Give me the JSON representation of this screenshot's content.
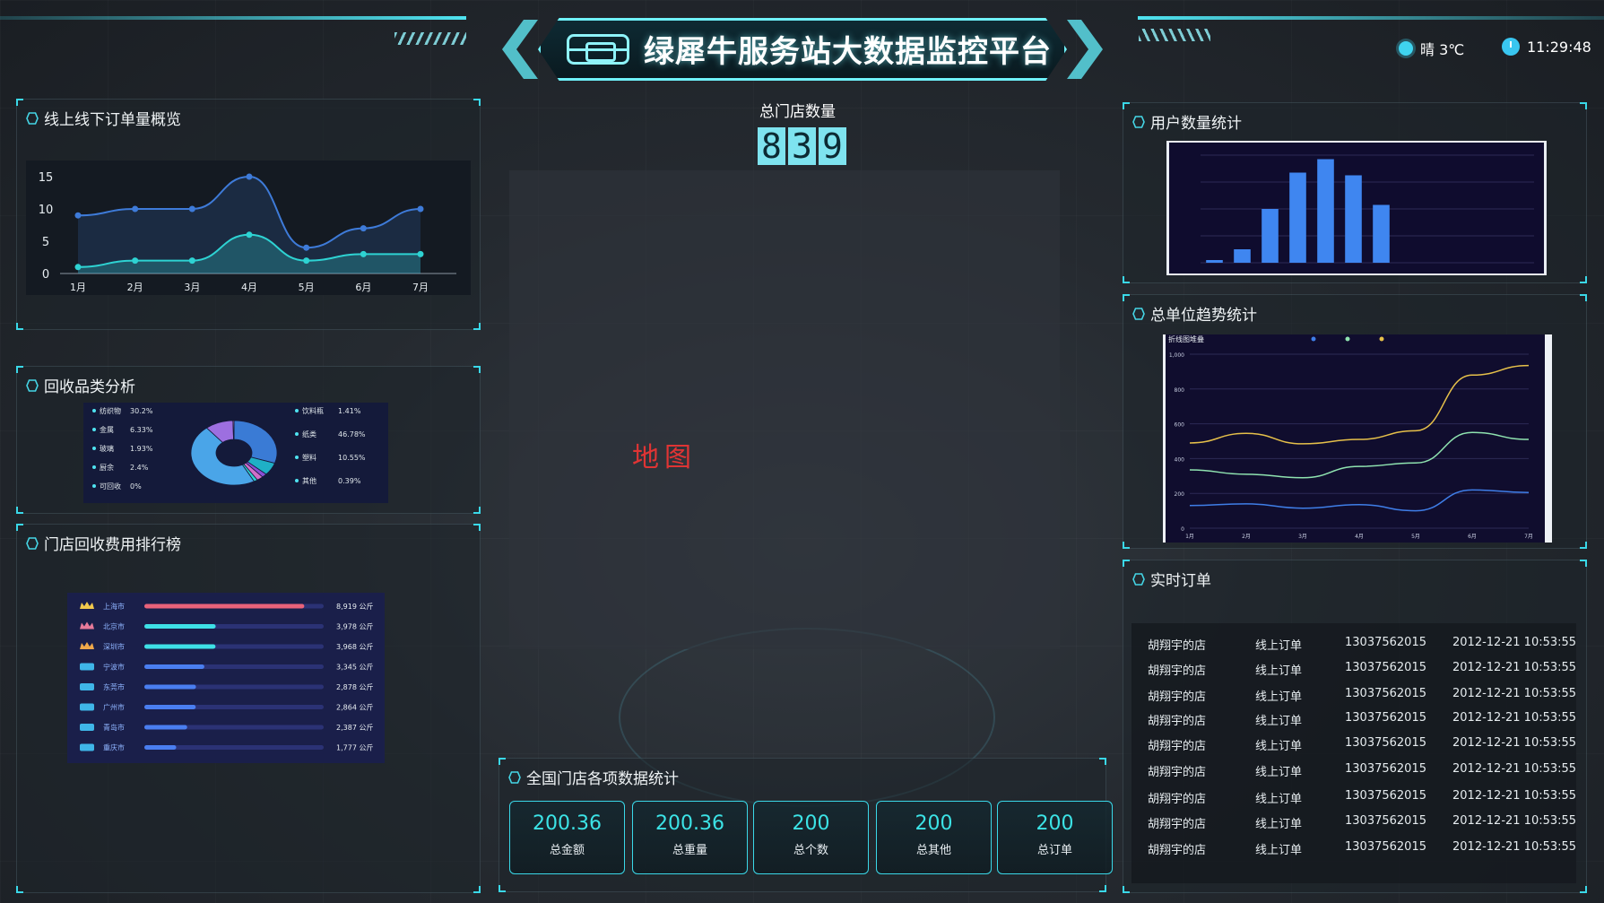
{
  "header": {
    "title": "绿犀牛服务站大数据监控平台",
    "weather": "晴 3℃",
    "time": "11:29:48",
    "icons": [
      "logo-icon",
      "sun-icon",
      "clock-icon"
    ]
  },
  "panels": {
    "online_offline": "线上线下订单量概览",
    "recycle_category": "回收品类分析",
    "store_ranking": "门店回收费用排行榜",
    "user_stats": "用户数量统计",
    "unit_trend": "总单位趋势统计",
    "realtime_orders": "实时订单",
    "national_stats": "全国门店各项数据统计"
  },
  "store_count": {
    "label": "总门店数量",
    "digits": [
      "8",
      "3",
      "9"
    ]
  },
  "map": {
    "placeholder": "地图"
  },
  "stats": [
    {
      "value": "200.36",
      "label": "总金额"
    },
    {
      "value": "200.36",
      "label": "总重量"
    },
    {
      "value": "200",
      "label": "总个数"
    },
    {
      "value": "200",
      "label": "总其他"
    },
    {
      "value": "200",
      "label": "总订单"
    }
  ],
  "chart_data": [
    {
      "type": "area",
      "categories": [
        "1月",
        "2月",
        "3月",
        "4月",
        "5月",
        "6月",
        "7月"
      ],
      "series": [
        {
          "values": [
            9,
            10,
            10,
            15,
            4,
            7,
            10
          ],
          "color": "#3e7bd9"
        },
        {
          "values": [
            1,
            2,
            2,
            6,
            2,
            3,
            3
          ],
          "color": "#2ed3d3"
        }
      ],
      "yticks": [
        "0",
        "5",
        "10",
        "15"
      ],
      "ylim": [
        0,
        15
      ]
    },
    {
      "type": "pie",
      "legend_left": [
        {
          "label": "纺织物",
          "value": "30.2%"
        },
        {
          "label": "金属",
          "value": "6.33%"
        },
        {
          "label": "玻璃",
          "value": "1.93%"
        },
        {
          "label": "厨余",
          "value": "2.4%"
        },
        {
          "label": "可回收",
          "value": "0%"
        }
      ],
      "legend_right": [
        {
          "label": "饮料瓶",
          "value": "1.41%"
        },
        {
          "label": "纸类",
          "value": "46.78%"
        },
        {
          "label": "塑料",
          "value": "10.55%"
        },
        {
          "label": "其他",
          "value": "0.39%"
        }
      ],
      "slices": [
        30.2,
        6.33,
        1.93,
        2.4,
        0,
        1.41,
        46.78,
        10.55,
        0.39
      ]
    },
    {
      "type": "bar",
      "orientation": "horizontal",
      "rows": [
        {
          "name": "上海市",
          "value": 8919,
          "label": "8,919 公斤"
        },
        {
          "name": "北京市",
          "value": 3978,
          "label": "3,978 公斤"
        },
        {
          "name": "深圳市",
          "value": 3968,
          "label": "3,968 公斤"
        },
        {
          "name": "宁波市",
          "value": 3345,
          "label": "3,345 公斤"
        },
        {
          "name": "东莞市",
          "value": 2878,
          "label": "2,878 公斤"
        },
        {
          "name": "广州市",
          "value": 2864,
          "label": "2,864 公斤"
        },
        {
          "name": "青岛市",
          "value": 2387,
          "label": "2,387 公斤"
        },
        {
          "name": "重庆市",
          "value": 1777,
          "label": "1,777 公斤"
        }
      ],
      "xlim": [
        0,
        10000
      ]
    },
    {
      "type": "bar",
      "values": [
        2,
        10,
        40,
        67,
        77,
        65,
        43,
        0,
        0,
        0,
        0,
        0
      ],
      "ylim": [
        0,
        80
      ],
      "color": "#3f86f0"
    },
    {
      "type": "line",
      "title": "折线图堆叠",
      "categories": [
        "1月",
        "2月",
        "3月",
        "4月",
        "5月",
        "6月",
        "7月"
      ],
      "series": [
        {
          "values": [
            130,
            140,
            115,
            135,
            100,
            220,
            205
          ],
          "color": "#3f7ee8"
        },
        {
          "values": [
            335,
            310,
            290,
            355,
            375,
            550,
            510
          ],
          "color": "#8fe3b0"
        },
        {
          "values": [
            490,
            545,
            485,
            510,
            560,
            880,
            935
          ],
          "color": "#e6c04a"
        }
      ],
      "yticks": [
        "0",
        "200",
        "400",
        "600",
        "800",
        "1,000"
      ],
      "ylim": [
        0,
        1000
      ]
    }
  ],
  "orders": {
    "rows": [
      {
        "store": "胡翔宇的店",
        "type": "线上订单",
        "phone": "13037562015",
        "time": "2012-12-21 10:53:55"
      },
      {
        "store": "胡翔宇的店",
        "type": "线上订单",
        "phone": "13037562015",
        "time": "2012-12-21 10:53:55"
      },
      {
        "store": "胡翔宇的店",
        "type": "线上订单",
        "phone": "13037562015",
        "time": "2012-12-21 10:53:55"
      },
      {
        "store": "胡翔宇的店",
        "type": "线上订单",
        "phone": "13037562015",
        "time": "2012-12-21 10:53:55"
      },
      {
        "store": "胡翔宇的店",
        "type": "线上订单",
        "phone": "13037562015",
        "time": "2012-12-21 10:53:55"
      },
      {
        "store": "胡翔宇的店",
        "type": "线上订单",
        "phone": "13037562015",
        "time": "2012-12-21 10:53:55"
      },
      {
        "store": "胡翔宇的店",
        "type": "线上订单",
        "phone": "13037562015",
        "time": "2012-12-21 10:53:55"
      },
      {
        "store": "胡翔宇的店",
        "type": "线上订单",
        "phone": "13037562015",
        "time": "2012-12-21 10:53:55"
      },
      {
        "store": "胡翔宇的店",
        "type": "线上订单",
        "phone": "13037562015",
        "time": "2012-12-21 10:53:55"
      }
    ]
  }
}
